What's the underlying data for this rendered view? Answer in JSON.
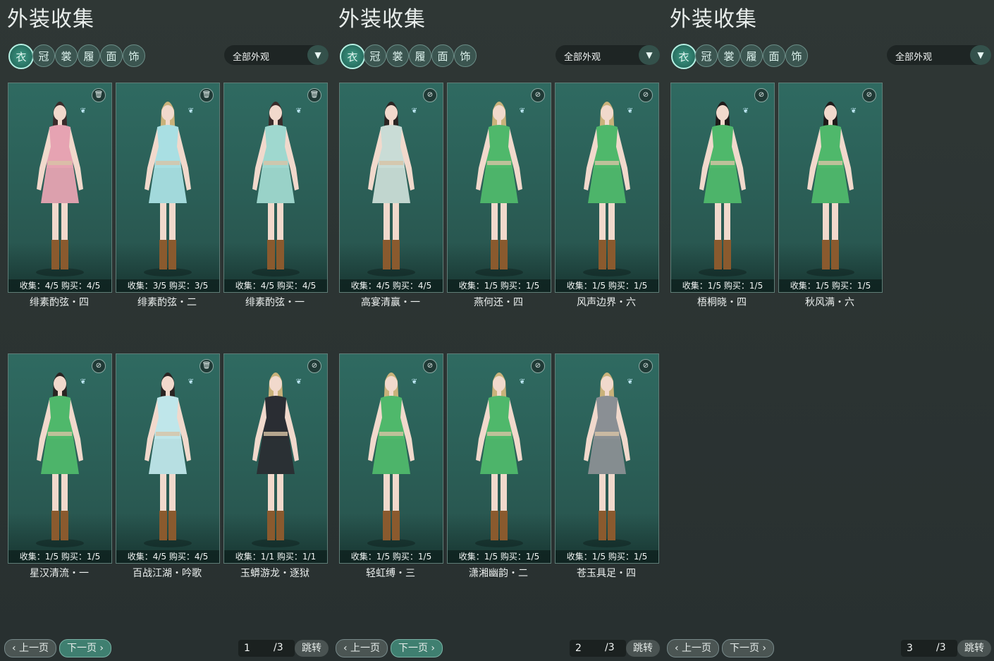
{
  "title": "外装收集",
  "filter_label": "全部外观",
  "category_icons": [
    "outfit-icon",
    "headwear-icon",
    "top-icon",
    "shoes-icon",
    "mask-icon",
    "accessory-icon"
  ],
  "pager": {
    "prev": "上一页",
    "next": "下一页",
    "jump": "跳转",
    "total": "/3"
  },
  "panels": [
    {
      "page": "1",
      "cards": [
        {
          "name": "绯素酌弦・四",
          "collect": "收集：4/5",
          "buy": "购买：4/5",
          "action": "trash",
          "hair": "#3a2b2a",
          "dress": "#e6a3b2"
        },
        {
          "name": "绯素酌弦・二",
          "collect": "收集：3/5",
          "buy": "购买：3/5",
          "action": "trash",
          "hair": "#c9b27a",
          "dress": "#a9dfe3"
        },
        {
          "name": "绯素酌弦・一",
          "collect": "收集：4/5",
          "buy": "购买：4/5",
          "action": "trash",
          "hair": "#3a2b2a",
          "dress": "#9fd8cf"
        },
        {
          "name": "星汉清流・一",
          "collect": "收集：1/5",
          "buy": "购买：1/5",
          "action": "lock",
          "hair": "#2a2422",
          "dress": "#4fb86b"
        },
        {
          "name": "百战江湖・吟歌",
          "collect": "收集：4/5",
          "buy": "购买：4/5",
          "action": "trash",
          "hair": "#2a2422",
          "dress": "#bfe6ea"
        },
        {
          "name": "玉蟒游龙・逐狱",
          "collect": "收集：1/1",
          "buy": "购买：1/1",
          "action": "lock",
          "hair": "#c9b27a",
          "dress": "#2a2d33"
        }
      ]
    },
    {
      "page": "2",
      "cards": [
        {
          "name": "高宴清赢・一",
          "collect": "收集：4/5",
          "buy": "购买：4/5",
          "action": "lock",
          "hair": "#2a2422",
          "dress": "#c9dcd6"
        },
        {
          "name": "燕何还・四",
          "collect": "收集：1/5",
          "buy": "购买：1/5",
          "action": "lock",
          "hair": "#c9b27a",
          "dress": "#4fb86b"
        },
        {
          "name": "风声边界・六",
          "collect": "收集：1/5",
          "buy": "购买：1/5",
          "action": "lock",
          "hair": "#c9b27a",
          "dress": "#4fb86b"
        },
        {
          "name": "轻虹缚・三",
          "collect": "收集：1/5",
          "buy": "购买：1/5",
          "action": "lock",
          "hair": "#c9b27a",
          "dress": "#4fb86b"
        },
        {
          "name": "潇湘幽韵・二",
          "collect": "收集：1/5",
          "buy": "购买：1/5",
          "action": "lock",
          "hair": "#c9b27a",
          "dress": "#4fb86b"
        },
        {
          "name": "苍玉具足・四",
          "collect": "收集：1/5",
          "buy": "购买：1/5",
          "action": "lock",
          "hair": "#c9b27a",
          "dress": "#8a8f94"
        }
      ]
    },
    {
      "page": "3",
      "cards": [
        {
          "name": "梧桐晓・四",
          "collect": "收集：1/5",
          "buy": "购买：1/5",
          "action": "lock",
          "hair": "#1f1a19",
          "dress": "#4fb86b"
        },
        {
          "name": "秋风满・六",
          "collect": "收集：1/5",
          "buy": "购买：1/5",
          "action": "lock",
          "hair": "#1f1a19",
          "dress": "#4fb86b"
        }
      ]
    }
  ]
}
